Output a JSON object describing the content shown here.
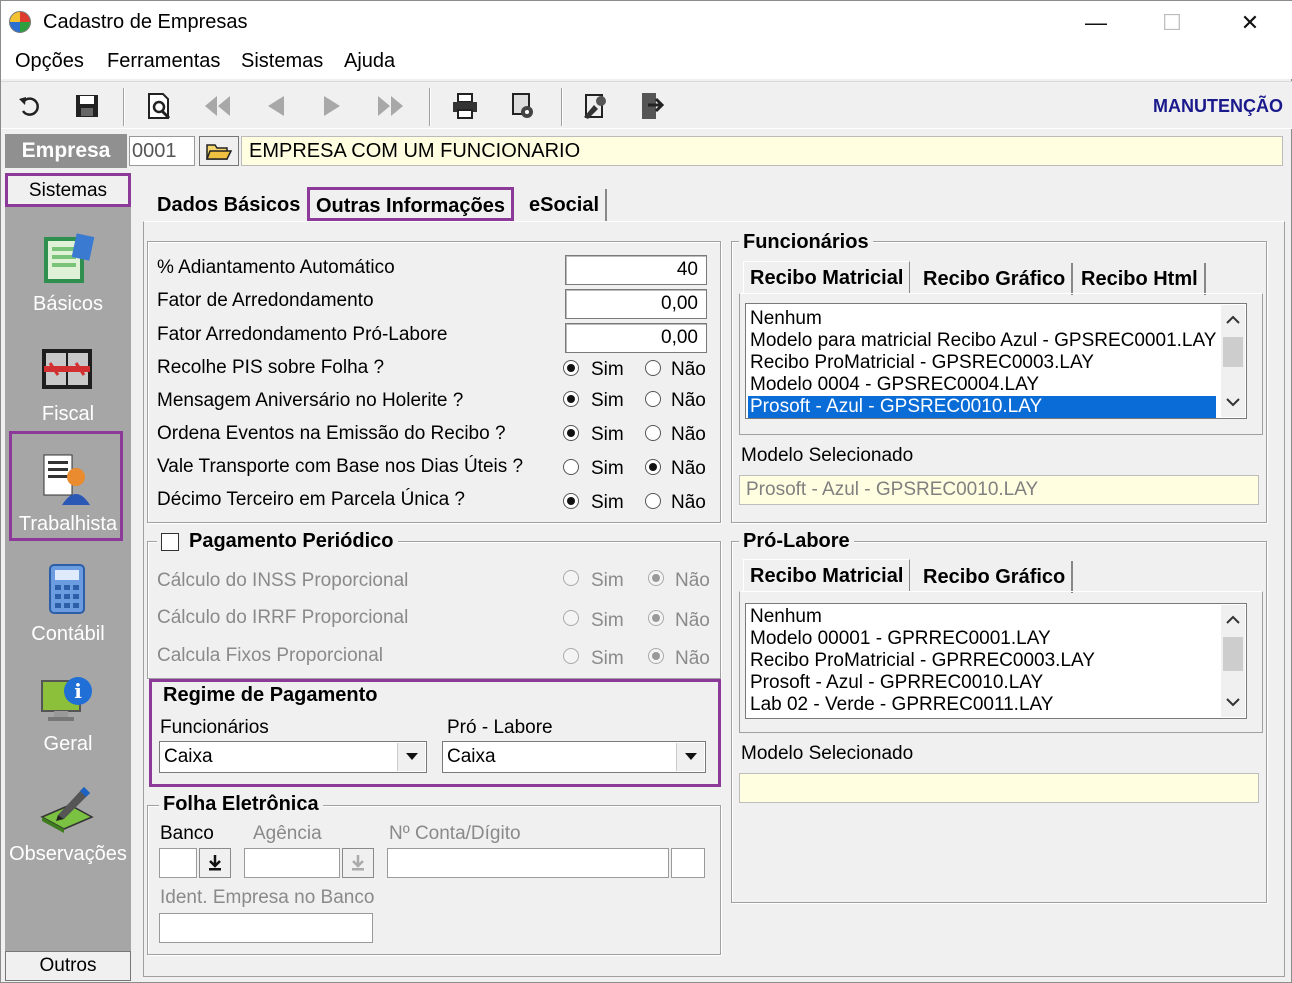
{
  "window": {
    "title": "Cadastro de Empresas",
    "minimize": "—",
    "maximize": "☐",
    "close": "✕"
  },
  "menu": [
    "Opções",
    "Ferramentas",
    "Sistemas",
    "Ajuda"
  ],
  "toolbar": {
    "icons": [
      "undo-icon",
      "save-icon",
      "preview-icon",
      "first-record-icon",
      "previous-record-icon",
      "next-record-icon",
      "last-record-icon",
      "print-icon",
      "settings-icon",
      "tools-icon",
      "exit-icon"
    ],
    "mode": "MANUTENÇÃO"
  },
  "empresa": {
    "label": "Empresa",
    "code": "0001",
    "name": "EMPRESA COM UM FUNCIONARIO"
  },
  "sidebar": {
    "title": "Sistemas",
    "items": [
      {
        "label": "Básicos",
        "icon": "basicos-icon"
      },
      {
        "label": "Fiscal",
        "icon": "fiscal-icon"
      },
      {
        "label": "Trabalhista",
        "icon": "trabalhista-icon"
      },
      {
        "label": "Contábil",
        "icon": "contabil-icon"
      },
      {
        "label": "Geral",
        "icon": "geral-icon"
      },
      {
        "label": "Observações",
        "icon": "observacoes-icon"
      }
    ],
    "footer": "Outros"
  },
  "tabs": [
    "Dados Básicos",
    "Outras Informações",
    "eSocial"
  ],
  "settings": {
    "rows": [
      {
        "label": "% Adiantamento Automático",
        "value": "40"
      },
      {
        "label": "Fator de Arredondamento",
        "value": "0,00"
      },
      {
        "label": "Fator Arredondamento Pró-Labore",
        "value": "0,00"
      }
    ],
    "radios": [
      {
        "label": "Recolhe PIS sobre Folha ?",
        "selected": "Sim"
      },
      {
        "label": "Mensagem Aniversário no Holerite ?",
        "selected": "Sim"
      },
      {
        "label": "Ordena Eventos na Emissão do Recibo ?",
        "selected": "Sim"
      },
      {
        "label": "Vale Transporte com Base nos Dias Úteis ?",
        "selected": "Não"
      },
      {
        "label": "Décimo Terceiro em Parcela Única ?",
        "selected": "Sim"
      }
    ],
    "sim": "Sim",
    "nao": "Não"
  },
  "pagamento": {
    "title": "Pagamento Periódico",
    "checked": false,
    "rows": [
      "Cálculo do INSS Proporcional",
      "Cálculo do IRRF Proporcional",
      "Calcula Fixos Proporcional"
    ]
  },
  "regime": {
    "title": "Regime de Pagamento",
    "func_label": "Funcionários",
    "func_value": "Caixa",
    "pro_label": "Pró - Labore",
    "pro_value": "Caixa"
  },
  "folha": {
    "title": "Folha Eletrônica",
    "banco": "Banco",
    "agencia": "Agência",
    "conta": "Nº Conta/Dígito",
    "ident": "Ident. Empresa no Banco"
  },
  "funcionarios": {
    "title": "Funcionários",
    "tabs": [
      "Recibo Matricial",
      "Recibo Gráfico",
      "Recibo Html"
    ],
    "list": [
      "Nenhum",
      "Modelo para matricial Recibo Azul - GPSREC0001.LAY",
      "Recibo ProMatricial - GPSREC0003.LAY",
      "Modelo 0004 - GPSREC0004.LAY",
      "Prosoft - Azul - GPSREC0010.LAY"
    ],
    "selected_index": 4,
    "modelo_label": "Modelo Selecionado",
    "modelo_value": "Prosoft - Azul - GPSREC0010.LAY"
  },
  "prolabore": {
    "title": "Pró-Labore",
    "tabs": [
      "Recibo Matricial",
      "Recibo Gráfico"
    ],
    "list": [
      "Nenhum",
      "Modelo 00001 - GPRREC0001.LAY",
      "Recibo ProMatricial - GPRREC0003.LAY",
      "Prosoft - Azul - GPRREC0010.LAY",
      "Lab 02 - Verde - GPRREC0011.LAY"
    ],
    "modelo_label": "Modelo Selecionado",
    "modelo_value": ""
  },
  "colors": {
    "highlight": "#8b3a99",
    "selection": "#0a6cd6",
    "readonly": "#fffee0",
    "mode_text": "#1a1a8c"
  }
}
